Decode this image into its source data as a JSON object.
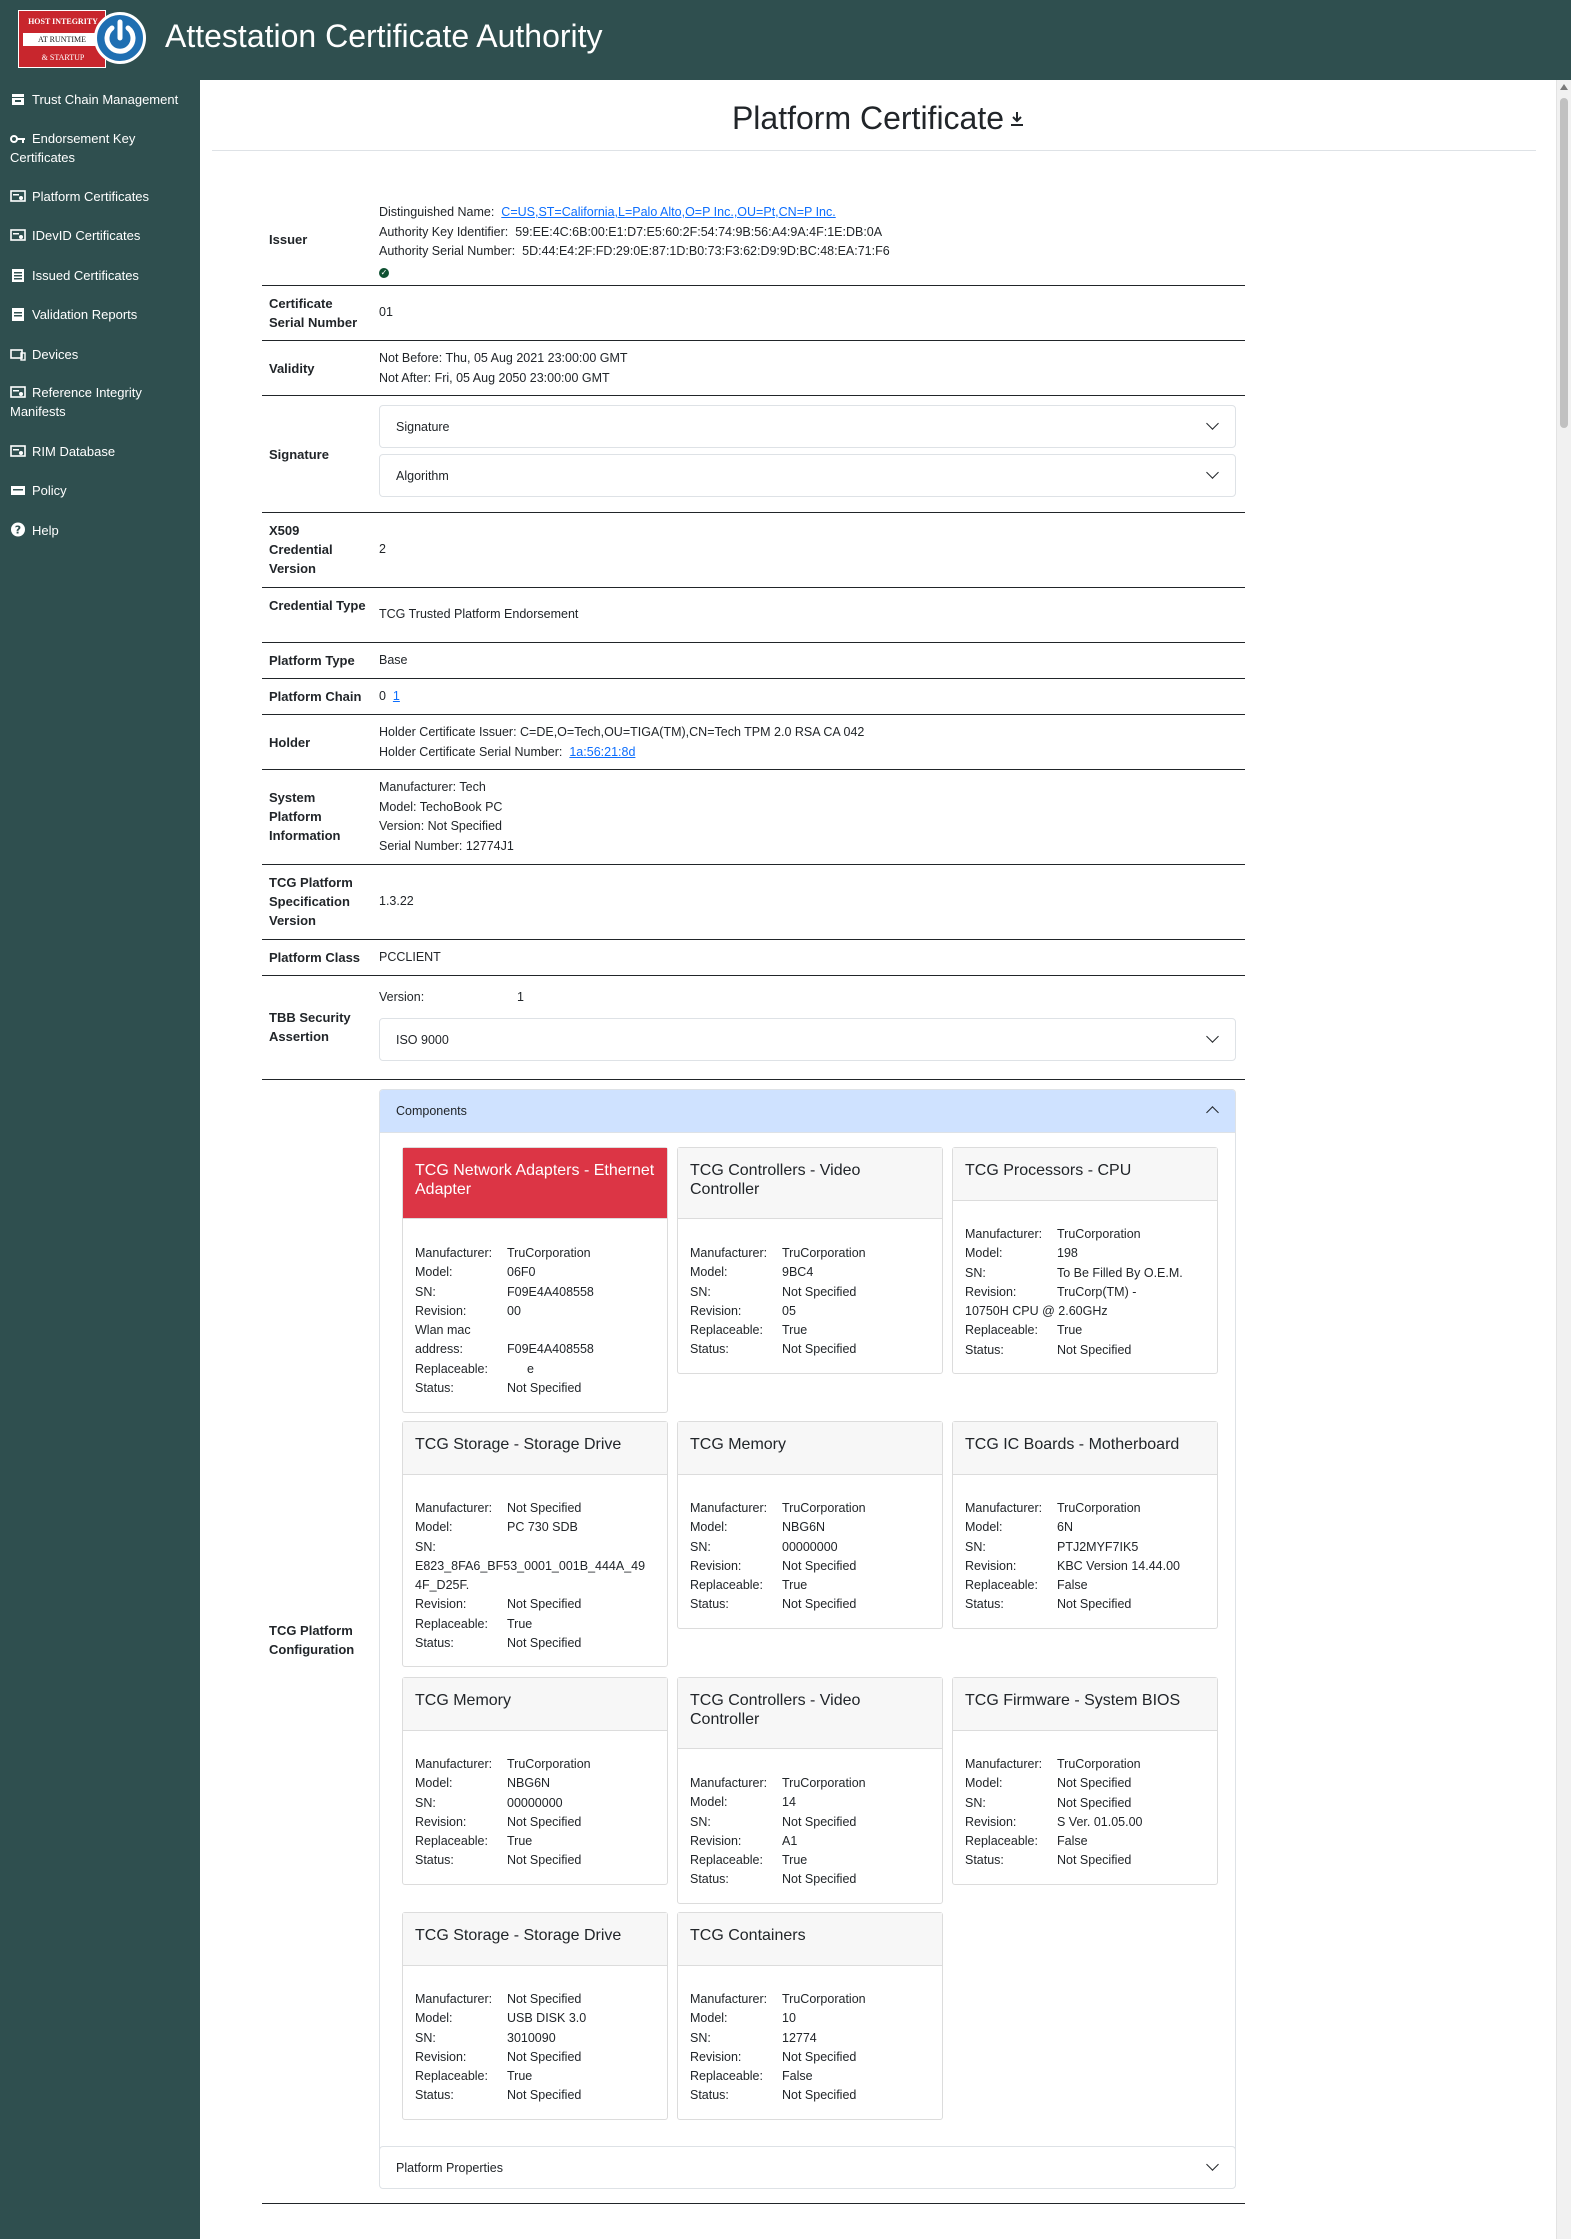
{
  "header": {
    "title": "Attestation Certificate Authority",
    "logo_lines": [
      "HOST INTEGRITY",
      "AT RUNTIME",
      "& STARTUP"
    ]
  },
  "sidebar": {
    "items": [
      {
        "label": "Trust Chain Management",
        "icon": "stack-icon"
      },
      {
        "label": "Endorsement Key Certificates",
        "icon": "key-icon"
      },
      {
        "label": "Platform Certificates",
        "icon": "certificate-icon"
      },
      {
        "label": "IDevID Certificates",
        "icon": "certificate-icon"
      },
      {
        "label": "Issued Certificates",
        "icon": "list-icon"
      },
      {
        "label": "Validation Reports",
        "icon": "report-icon"
      },
      {
        "label": "Devices",
        "icon": "laptop-icon"
      },
      {
        "label": "Reference Integrity Manifests",
        "icon": "certificate-icon"
      },
      {
        "label": "RIM Database",
        "icon": "certificate-icon"
      },
      {
        "label": "Policy",
        "icon": "policy-icon"
      },
      {
        "label": "Help",
        "icon": "help-icon"
      }
    ]
  },
  "page": {
    "title": "Platform Certificate",
    "download_icon": "download-icon"
  },
  "details": {
    "issuer": {
      "label": "Issuer",
      "dn_label": "Distinguished Name:",
      "dn_value": "C=US,ST=California,L=Palo Alto,O=P Inc.,OU=Pt,CN=P Inc.",
      "aki_label": "Authority Key Identifier:",
      "aki_value": "59:EE:4C:6B:00:E1:D7:E5:60:2F:54:74:9B:56:A4:9A:4F:1E:DB:0A",
      "asn_label": "Authority Serial Number:",
      "asn_value": "5D:44:E4:2F:FD:29:0E:87:1D:B0:73:F3:62:D9:9D:BC:48:EA:71:F6",
      "status_icon": "check-circle-icon"
    },
    "serial": {
      "label": "Certificate Serial Number",
      "value": "01"
    },
    "validity": {
      "label": "Validity",
      "not_before": "Not Before: Thu, 05 Aug 2021 23:00:00 GMT",
      "not_after": "Not After: Fri, 05 Aug 2050 23:00:00 GMT"
    },
    "signature": {
      "label": "Signature",
      "accordion1": "Signature",
      "accordion2": "Algorithm"
    },
    "x509_version": {
      "label": "X509 Credential Version",
      "value": "2"
    },
    "credential_type": {
      "label": "Credential Type",
      "value": "TCG Trusted Platform Endorsement"
    },
    "platform_type": {
      "label": "Platform Type",
      "value": "Base"
    },
    "platform_chain": {
      "label": "Platform Chain",
      "value0": "0",
      "value1": "1"
    },
    "holder": {
      "label": "Holder",
      "issuer_text": "Holder Certificate Issuer: C=DE,O=Tech,OU=TIGA(TM),CN=Tech TPM 2.0 RSA CA 042",
      "serial_label": "Holder Certificate Serial Number:",
      "serial_value": "1a:56:21:8d"
    },
    "system_platform": {
      "label": "System Platform Information",
      "manufacturer": "Manufacturer: Tech",
      "model": "Model: TechoBook PC",
      "version": "Version: Not Specified",
      "serial": "Serial Number: 12774J1"
    },
    "tcg_spec_version": {
      "label": "TCG Platform Specification Version",
      "value": "1.3.22"
    },
    "platform_class": {
      "label": "Platform Class",
      "value": "PCCLIENT"
    },
    "tbb": {
      "label": "TBB Security Assertion",
      "version_label": "Version:",
      "version_value": "1",
      "accordion": "ISO 9000"
    },
    "tcg_config": {
      "label": "TCG Platform Configuration",
      "components_header": "Components",
      "properties_header": "Platform Properties"
    }
  },
  "field_labels": {
    "manufacturer": "Manufacturer:",
    "model": "Model:",
    "sn": "SN:",
    "revision": "Revision:",
    "replaceable": "Replaceable:",
    "status": "Status:",
    "wlan1": "Wlan mac",
    "wlan2": "address:"
  },
  "components": [
    {
      "title": "TCG Network Adapters - Ethernet Adapter",
      "failed": true,
      "manufacturer": "TruCorporation",
      "model": "06F0",
      "sn": "F09E4A408558",
      "revision": "00",
      "wlan": "F09E4A408558",
      "replaceable": "e",
      "status": "Not Specified"
    },
    {
      "title": "TCG Controllers - Video Controller",
      "manufacturer": "TruCorporation",
      "model": "9BC4",
      "sn": "Not Specified",
      "revision": "05",
      "replaceable": "True",
      "status": "Not Specified"
    },
    {
      "title": "TCG Processors - CPU",
      "manufacturer": "TruCorporation",
      "model": "198",
      "sn": "To Be Filled By O.E.M.",
      "revision": "TruCorp(TM) -",
      "revision2": "10750H CPU @ 2.60GHz",
      "replaceable": "True",
      "status": "Not Specified"
    },
    {
      "title": "TCG Storage - Storage Drive",
      "manufacturer": "Not Specified",
      "model": "PC 730 SDB",
      "sn": "E823_8FA6_BF53_0001_001B_444A_494F_D25F.",
      "revision": "Not Specified",
      "replaceable": "True",
      "status": "Not Specified"
    },
    {
      "title": "TCG Memory",
      "manufacturer": "TruCorporation",
      "model": "NBG6N",
      "sn": "00000000",
      "revision": "Not Specified",
      "replaceable": "True",
      "status": "Not Specified"
    },
    {
      "title": "TCG IC Boards - Motherboard",
      "manufacturer": "TruCorporation",
      "model": "6N",
      "sn": "PTJ2MYF7IK5",
      "revision": "KBC Version 14.44.00",
      "replaceable": "False",
      "status": "Not Specified"
    },
    {
      "title": "TCG Memory",
      "manufacturer": "TruCorporation",
      "model": "NBG6N",
      "sn": "00000000",
      "revision": "Not Specified",
      "replaceable": "True",
      "status": "Not Specified"
    },
    {
      "title": "TCG Controllers - Video Controller",
      "manufacturer": "TruCorporation",
      "model": "14",
      "sn": "Not Specified",
      "revision": "A1",
      "replaceable": "True",
      "status": "Not Specified"
    },
    {
      "title": "TCG Firmware - System BIOS",
      "manufacturer": "TruCorporation",
      "model": "Not Specified",
      "sn": "Not Specified",
      "revision": "S Ver. 01.05.00",
      "replaceable": "False",
      "status": "Not Specified"
    },
    {
      "title": "TCG Storage - Storage Drive",
      "manufacturer": "Not Specified",
      "model": "USB DISK 3.0",
      "sn": "3010090",
      "revision": "Not Specified",
      "replaceable": "True",
      "status": "Not Specified"
    },
    {
      "title": "TCG Containers",
      "manufacturer": "TruCorporation",
      "model": "10",
      "sn": "12774",
      "revision": "Not Specified",
      "replaceable": "False",
      "status": "Not Specified"
    }
  ]
}
